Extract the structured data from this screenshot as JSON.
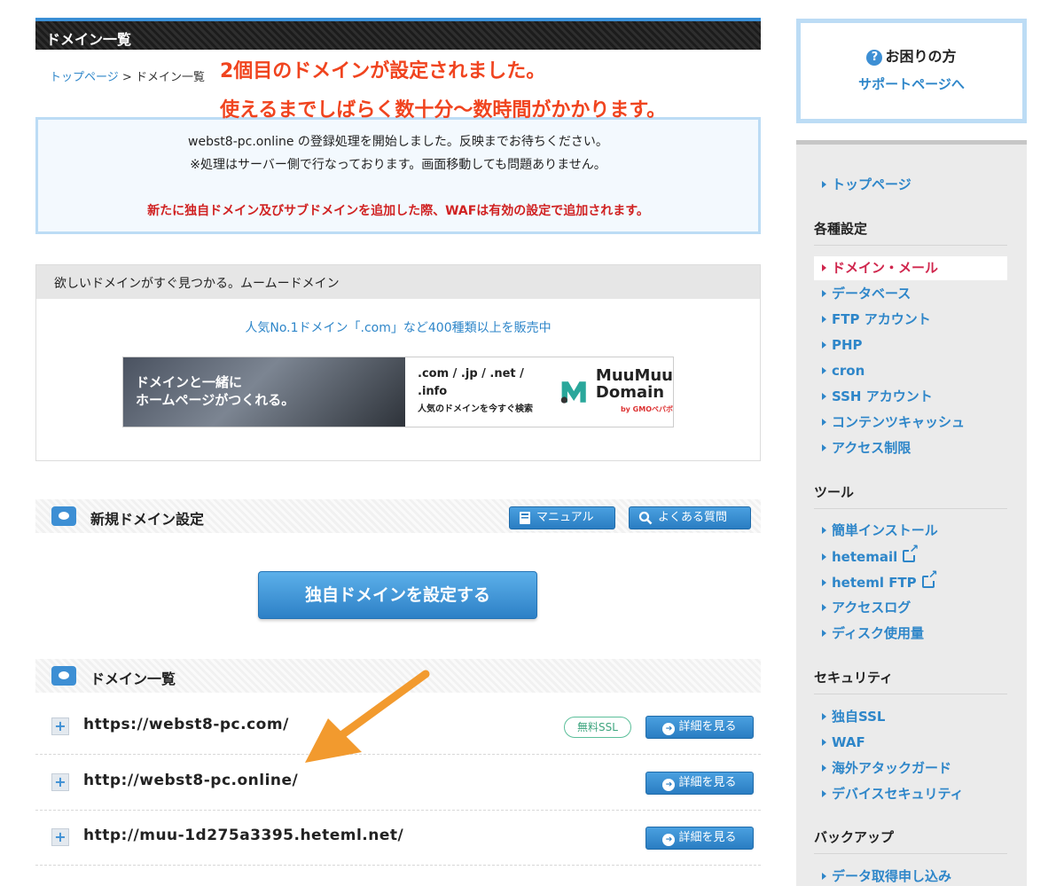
{
  "header": {
    "title": "ドメイン一覧"
  },
  "breadcrumb": {
    "home": "トップページ",
    "sep": ">",
    "current": "ドメイン一覧"
  },
  "annotation": {
    "line1": "2個目のドメインが設定されました。",
    "line2": "使えるまでしばらく数十分〜数時間がかかります。",
    "color": "#f0441f"
  },
  "notice": {
    "line1": "webst8-pc.online の登録処理を開始しました。反映までお待ちください。",
    "line2": "※処理はサーバー側で行なっております。画面移動しても問題ありません。",
    "line3": "新たに独自ドメイン及びサブドメインを追加した際、WAFは有効の設定で追加されます。"
  },
  "promo": {
    "header": "欲しいドメインがすぐ見つかる。ムームードメイン",
    "link": "人気No.1ドメイン「.com」など400種類以上を販売中",
    "banner": {
      "photo_line1": "ドメインと一緒に",
      "photo_line2": "ホームページがつくれる。",
      "tlds": ".com / .jp / .net / .info",
      "tagline": "人気のドメインを今すぐ検索",
      "logo_line1": "MuuMuu",
      "logo_line2": "Domain",
      "logo_by": "by GMOペパボ"
    }
  },
  "new_domain_section": {
    "title": "新規ドメイン設定",
    "manual_label": "マニュアル",
    "faq_label": "よくある質問",
    "action_label": "独自ドメインを設定する"
  },
  "domain_list": {
    "title": "ドメイン一覧",
    "detail_label": "詳細を見る",
    "ssl_label": "無料SSL",
    "rows": [
      {
        "domain": "https://webst8-pc.com/",
        "ssl": true
      },
      {
        "domain": "http://webst8-pc.online/",
        "ssl": false
      },
      {
        "domain": "http://muu-1d275a3395.heteml.net/",
        "ssl": false
      }
    ]
  },
  "help": {
    "title": "お困りの方",
    "link": "サポートページへ"
  },
  "sidebar": {
    "top": "トップページ",
    "groups": [
      {
        "title": "各種設定",
        "items": [
          "ドメイン・メール",
          "データベース",
          "FTP アカウント",
          "PHP",
          "cron",
          "SSH アカウント",
          "コンテンツキャッシュ",
          "アクセス制限"
        ]
      },
      {
        "title": "ツール",
        "items": [
          "簡単インストール",
          "hetemail",
          "heteml FTP",
          "アクセスログ",
          "ディスク使用量"
        ]
      },
      {
        "title": "セキュリティ",
        "items": [
          "独自SSL",
          "WAF",
          "海外アタックガード",
          "デバイスセキュリティ"
        ]
      },
      {
        "title": "バックアップ",
        "items": [
          "データ取得申し込み"
        ]
      }
    ],
    "active_item": "ドメイン・メール"
  },
  "colors": {
    "accent": "#2e86c9",
    "active": "#d0264d",
    "warning": "#d02222",
    "arrow": "#f29a2e"
  }
}
